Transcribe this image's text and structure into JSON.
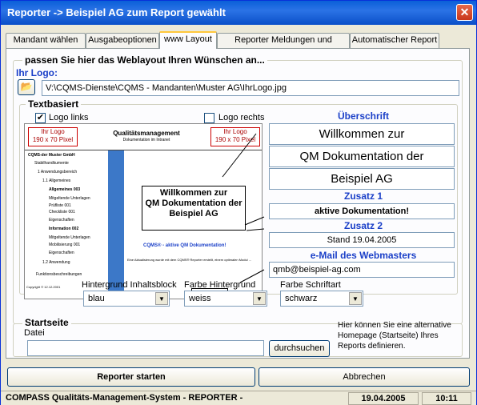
{
  "window": {
    "title": "Reporter -> Beispiel AG zum Report gewählt",
    "close": "✕"
  },
  "tabs": [
    "Mandant wählen",
    "Ausgabeoptionen",
    "www Layout",
    "Reporter Meldungen und Aktionen",
    "Automatischer Report"
  ],
  "layout_group": {
    "title": "passen Sie hier das Weblayout Ihren Wünschen an...",
    "logo_label": "Ihr Logo:",
    "logo_path": "V:\\CQMS-Dienste\\CQMS - Mandanten\\Muster AG\\IhrLogo.jpg"
  },
  "textbasiert": {
    "title": "Textbasiert",
    "logo_links": "Logo links",
    "logo_rechts": "Logo rechts",
    "logo_links_checked": "✔"
  },
  "preview": {
    "logo_box1": "Ihr Logo\n190 x 70 Pixel",
    "title": "Qualitätsmanagement",
    "subtitle": "Dokumentation im Intranet",
    "logo_box2": "Ihr Logo\n190 x 70 Pixel",
    "company": "CQMS-der Muster GmbH",
    "tree": [
      "Stabilhandkumente",
      "1 Anwendungsbereich",
      "1.1 Allgemeines",
      "Allgemeines 003",
      "Mitgeltende Unterlagen",
      "Prüfliste 001",
      "Checkliste 001",
      "Eigenschaften",
      "Information 002",
      "Mitgeltende Unterlagen",
      "Mobilisierung 001",
      "Eigenschaften",
      "1.2 Anwendung",
      "Funktionsbeschreibungen"
    ],
    "welcome": "Willkommen zur\nQM Dokumentation der\nBeispiel AG",
    "tagline": "CQMS® - aktive QM Dokumentation!",
    "stand": "Eine Aktualisierung wurde mit dem CQMS® Reporter erstellt, einem optimalen Modul ...",
    "footer_left": "Copyright © 12.12.2001",
    "footer_right": "Mail an den Webmaster"
  },
  "ueberschrift": {
    "label": "Überschrift",
    "line1": "Willkommen zur",
    "line2": "QM Dokumentation der",
    "line3": "Beispiel AG"
  },
  "zusatz1": {
    "label": "Zusatz 1",
    "value": "aktive Dokumentation!"
  },
  "zusatz2": {
    "label": "Zusatz 2",
    "value": "Stand 19.04.2005"
  },
  "email": {
    "label": "e-Mail des Webmasters",
    "value": "qmb@beispiel-ag.com"
  },
  "selects": {
    "hintergrund_label": "Hintergrund Inhaltsblock",
    "hintergrund_value": "blau",
    "farbe_hg_label": "Farbe Hintergrund",
    "farbe_hg_value": "weiss",
    "schrift_label": "Farbe Schriftart",
    "schrift_value": "schwarz"
  },
  "startseite": {
    "title": "Startseite",
    "datei_label": "Datei",
    "browse": "durchsuchen",
    "hint": "Hier können Sie eine alternative Homepage (Startseite) Ihres Reports definieren."
  },
  "buttons": {
    "start": "Reporter starten",
    "cancel": "Abbrechen"
  },
  "status": {
    "text": "COMPASS Qualitäts-Management-System - REPORTER -",
    "date": "19.04.2005",
    "time": "10:11"
  },
  "colors": {
    "accent": "#1a3fc8",
    "titlebar": "#0a5fd8",
    "preview_blue": "#3c78c8"
  }
}
